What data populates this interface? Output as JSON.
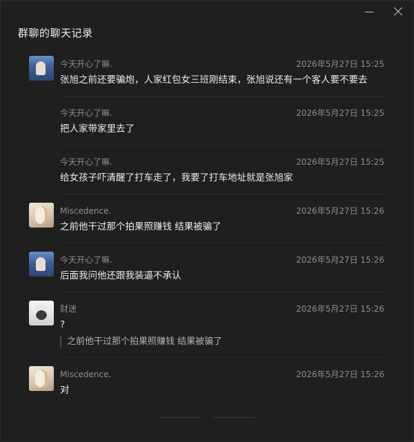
{
  "window": {
    "title": "群聊的聊天记录",
    "minimize_icon": "minimize-icon",
    "close_icon": "close-icon"
  },
  "messages": [
    {
      "avatar": "avatar-blue",
      "name": "今天开心了嘛.",
      "time": "2026年5月27日 15:25",
      "text": "张旭之前还要骗炮，人家红包女三班刚结束，张旭说还有一个客人要不要去",
      "show_avatar": true
    },
    {
      "avatar": "",
      "name": "今天开心了嘛.",
      "time": "2026年5月27日 15:25",
      "text": "把人家带家里去了",
      "show_avatar": false
    },
    {
      "avatar": "",
      "name": "今天开心了嘛.",
      "time": "2026年5月27日 15:25",
      "text": "给女孩子吓清醒了打车走了，我要了打车地址就是张旭家",
      "show_avatar": false
    },
    {
      "avatar": "avatar-light",
      "name": "Miscedence.",
      "time": "2026年5月27日 15:26",
      "text": "之前他干过那个拍果照赚钱 结果被骗了",
      "show_avatar": true
    },
    {
      "avatar": "avatar-blue",
      "name": "今天开心了嘛.",
      "time": "2026年5月27日 15:26",
      "text": "后面我问他还跟我装逼不承认",
      "show_avatar": true
    },
    {
      "avatar": "avatar-white",
      "name": "财迷",
      "time": "2026年5月27日 15:26",
      "text": "?",
      "quote": "之前他干过那个拍果照赚钱 结果被骗了",
      "show_avatar": true
    },
    {
      "avatar": "avatar-light",
      "name": "Miscedence.",
      "time": "2026年5月27日 15:26",
      "text": "对",
      "show_avatar": true
    }
  ]
}
